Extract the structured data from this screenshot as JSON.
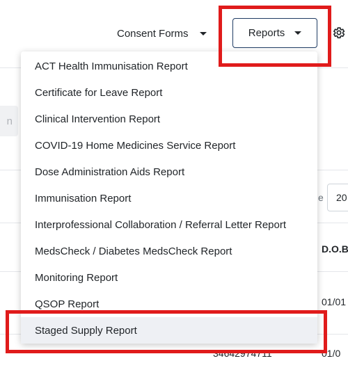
{
  "header": {
    "consent_label": "Consent Forms",
    "reports_label": "Reports"
  },
  "background": {
    "search_hint": "n",
    "page_size_label": "e",
    "page_size_value": "20",
    "col_dob": "D.O.B",
    "row1_dob": "01/01",
    "row2_id": "34642974711",
    "row2_dob": "01/0"
  },
  "menu": {
    "items": [
      "ACT Health Immunisation Report",
      "Certificate for Leave Report",
      "Clinical Intervention Report",
      "COVID-19 Home Medicines Service Report",
      "Dose Administration Aids Report",
      "Immunisation Report",
      "Interprofessional Collaboration / Referral Letter Report",
      "MedsCheck / Diabetes MedsCheck Report",
      "Monitoring Report",
      "QSOP Report",
      "Staged Supply Report"
    ],
    "active_item": "Staged Supply Report"
  },
  "colors": {
    "highlight": "#e01b1b",
    "button_border": "#1f3b63"
  },
  "icons": {
    "settings": "gear-icon",
    "dropdown": "caret-down-icon"
  }
}
